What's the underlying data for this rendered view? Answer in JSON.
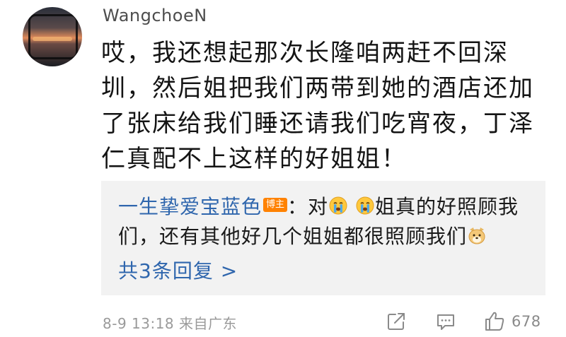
{
  "comment": {
    "username": "WangchoeN",
    "text": "哎，我还想起那次长隆咱两赶不回深圳，然后姐把我们两带到她的酒店还加了张床给我们睡还请我们吃宵夜，丁泽仁真配不上这样的好姐姐！",
    "avatar_icon": "sunset-window-avatar"
  },
  "reply": {
    "author": "一生挚爱宝蓝色",
    "badge": "博主",
    "separator": "：对",
    "text_after_emojis": "姐真的好照顾我们，还有其他好几个姐姐都很照顾我们",
    "emoji_cry_icon": "crying-face-emoji",
    "emoji_dog_icon": "dog-face-emoji",
    "more_replies_label": "共3条回复 >"
  },
  "footer": {
    "timestamp": "8-9 13:18 来自广东",
    "like_count": "678",
    "icons": {
      "share": "share-icon",
      "comment": "comment-icon",
      "like": "thumbs-up-icon"
    }
  },
  "colors": {
    "link_blue": "#2f66ad",
    "badge_orange": "#ff8200",
    "reply_bg": "#f2f2f2",
    "meta_gray": "#9a9a9a"
  }
}
